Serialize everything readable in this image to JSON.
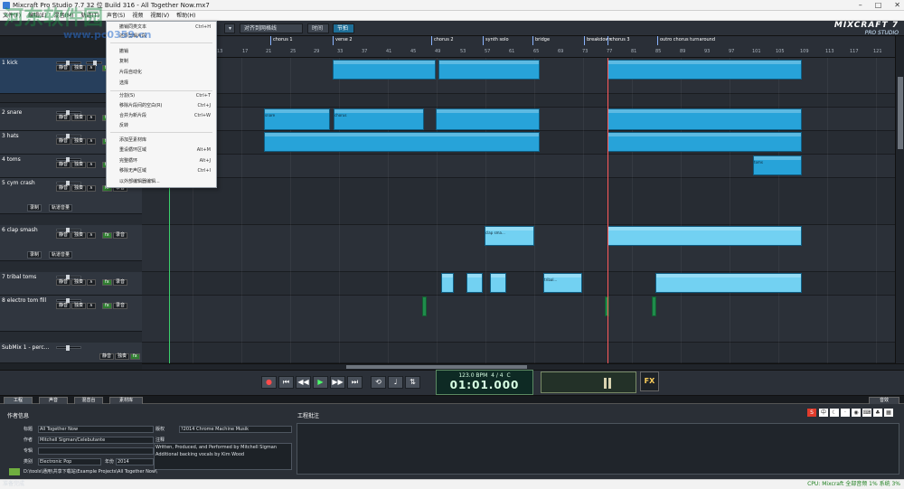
{
  "titlebar": {
    "title": "Mixcraft Pro Studio 7.7 32 位 Build 316 - All Together Now.mx7"
  },
  "menu_bar": [
    "文件(F)",
    "编辑(E)",
    "混音(M)",
    "轨道(T)",
    "声音(S)",
    "视频",
    "视图(V)",
    "帮助(H)"
  ],
  "edit_menu": [
    {
      "label": "撤销同类文本",
      "shortcut": "Ctrl+H"
    },
    {
      "label": "还原剪辑片段",
      "shortcut": ""
    },
    {
      "label": "撤销",
      "shortcut": ""
    },
    {
      "label": "复制",
      "shortcut": ""
    },
    {
      "label": "片段自动化",
      "shortcut": ""
    },
    {
      "label": "选择",
      "shortcut": ""
    },
    {
      "label": "分割(S)",
      "shortcut": "Ctrl+T"
    },
    {
      "label": "移除片段间的空白(R)",
      "shortcut": "Ctrl+J"
    },
    {
      "label": "合并为新片段",
      "shortcut": "Ctrl+W"
    },
    {
      "label": "反转",
      "shortcut": ""
    },
    {
      "label": "添加至素材库",
      "shortcut": ""
    },
    {
      "label": "重设循环区域",
      "shortcut": "Alt+M"
    },
    {
      "label": "完整循环",
      "shortcut": "Alt+J"
    },
    {
      "label": "移除无声区域",
      "shortcut": "Ctrl+I"
    },
    {
      "label": "以外部编辑器编辑...",
      "shortcut": ""
    }
  ],
  "toolbar": {
    "grid_menu": "对齐到网格线",
    "tab_time": "时间",
    "tab_beat": "节拍"
  },
  "logo": {
    "line1": "MIXCRAFT",
    "line2": "PRO STUDIO",
    "version": "7"
  },
  "markers": [
    "chorus 1",
    "verse 2",
    "chorus 2",
    "synth solo",
    "bridge",
    "breakdown",
    "chorus 3",
    "outro chorus turnaround"
  ],
  "beats": [
    "13",
    "17",
    "21",
    "25",
    "29",
    "33",
    "37",
    "41",
    "45",
    "49",
    "53",
    "57",
    "61",
    "65",
    "69",
    "73",
    "77",
    "81",
    "85",
    "89",
    "93",
    "97",
    "101",
    "105",
    "109",
    "113",
    "117",
    "121"
  ],
  "tracks": [
    {
      "name": "1 kick",
      "mute": "静音",
      "solo": "独奏",
      "fx": "fx",
      "rec": "录音"
    },
    {
      "name": "2 snare",
      "mute": "静音",
      "solo": "独奏",
      "fx": "fx",
      "rec": "录音"
    },
    {
      "name": "3 hats",
      "mute": "静音",
      "solo": "独奏",
      "fx": "fx",
      "rec": "录音"
    },
    {
      "name": "4 toms",
      "mute": "静音",
      "solo": "独奏",
      "fx": "fx",
      "rec": "录音"
    },
    {
      "name": "5 cym crash",
      "mute": "静音",
      "solo": "独奏",
      "fx": "fx",
      "rec": "录音"
    },
    {
      "name": "6 clap smash",
      "mute": "静音",
      "solo": "独奏",
      "fx": "fx",
      "rec": "录音"
    },
    {
      "name": "7 tribal toms",
      "mute": "静音",
      "solo": "独奏",
      "fx": "fx",
      "rec": "录音"
    },
    {
      "name": "8 electro tom fill",
      "mute": "静音",
      "solo": "独奏",
      "fx": "fx",
      "rec": "录音"
    },
    {
      "name": "SubMix 1 - perc...",
      "mute": "静音",
      "solo": "独奏",
      "fx": "fx",
      "rec": "录音"
    }
  ],
  "automation": {
    "record": "录制",
    "volume": "轨道音量"
  },
  "clip_labels": [
    "chorus",
    "snare",
    "clap sma...",
    "tribal...",
    "toms"
  ],
  "transport": {
    "bpm": "123.0 BPM",
    "sig": "4 / 4",
    "key": "C",
    "time": "01:01.000",
    "fx": "FX"
  },
  "tabs": [
    "工程",
    "声音",
    "混音台",
    "素材库"
  ],
  "right_tab": "音效",
  "info": {
    "header": "作者信息",
    "notes_header": "工程批注",
    "fields": [
      {
        "label": "标题",
        "value": "All Together Now"
      },
      {
        "label": "作者",
        "value": "Mitchell Sigman/Celebutante"
      },
      {
        "label": "专辑",
        "value": ""
      },
      {
        "label": "类别",
        "value": "Electronic Pop"
      },
      {
        "label": "年份",
        "value": "2014"
      },
      {
        "label": "版权",
        "value": "?2014 Chrome Machine Musik"
      },
      {
        "label": "注释",
        "value": "Written, Produced, and Performed by Mitchell Sigman"
      },
      {
        "label": "注释2",
        "value": "Additional backing vocals by Kim Wood"
      }
    ],
    "path": "D:\\tools\\通用\\共享下载站\\Example Projects\\All Together Now\\"
  },
  "status": {
    "left": "准备完成",
    "right": "CPU: Mixcraft 全部音频 1% 系统 3%"
  },
  "watermark": {
    "main": "河东软件园",
    "url": "www.pc0359.cn"
  },
  "colors": {
    "clip": "#27a3d9",
    "clip_light": "#72d1f2",
    "accent": "#1f6f98",
    "bg": "#1e2227"
  }
}
